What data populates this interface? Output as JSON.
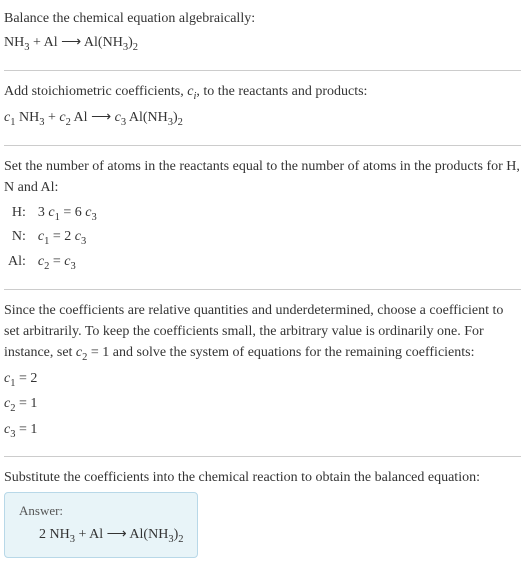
{
  "section1": {
    "title": "Balance the chemical equation algebraically:",
    "equation_left1": "NH",
    "equation_sub1": "3",
    "equation_mid1": " + Al ",
    "equation_arrow": "⟶",
    "equation_right1": " Al(NH",
    "equation_sub2": "3",
    "equation_right2": ")",
    "equation_sub3": "2"
  },
  "section2": {
    "text_a": "Add stoichiometric coefficients, ",
    "ci_c": "c",
    "ci_i": "i",
    "text_b": ", to the reactants and products:",
    "c1": "c",
    "c1s": "1",
    "t1": " NH",
    "s1": "3",
    "t2": " + ",
    "c2": "c",
    "c2s": "2",
    "t3": " Al ",
    "arrow": "⟶",
    "t4": " ",
    "c3": "c",
    "c3s": "3",
    "t5": " Al(NH",
    "s2": "3",
    "t6": ")",
    "s3": "2"
  },
  "section3": {
    "text": "Set the number of atoms in the reactants equal to the number of atoms in the products for H, N and Al:",
    "rows": [
      {
        "label": "H:",
        "lhs_a": "3 ",
        "lhs_c": "c",
        "lhs_s": "1",
        "eq": " = 6 ",
        "rhs_c": "c",
        "rhs_s": "3"
      },
      {
        "label": "N:",
        "lhs_a": "",
        "lhs_c": "c",
        "lhs_s": "1",
        "eq": " = 2 ",
        "rhs_c": "c",
        "rhs_s": "3"
      },
      {
        "label": "Al:",
        "lhs_a": "",
        "lhs_c": "c",
        "lhs_s": "2",
        "eq": " = ",
        "rhs_c": "c",
        "rhs_s": "3"
      }
    ]
  },
  "section4": {
    "text_a": "Since the coefficients are relative quantities and underdetermined, choose a coefficient to set arbitrarily. To keep the coefficients small, the arbitrary value is ordinarily one. For instance, set ",
    "c2c": "c",
    "c2s": "2",
    "text_b": " = 1 and solve the system of equations for the remaining coefficients:",
    "lines": [
      {
        "c": "c",
        "s": "1",
        "val": " = 2"
      },
      {
        "c": "c",
        "s": "2",
        "val": " = 1"
      },
      {
        "c": "c",
        "s": "3",
        "val": " = 1"
      }
    ]
  },
  "section5": {
    "text": "Substitute the coefficients into the chemical reaction to obtain the balanced equation:",
    "answer_label": "Answer:",
    "eq_a": "2 NH",
    "eq_s1": "3",
    "eq_b": " + Al ",
    "eq_arrow": "⟶",
    "eq_c": " Al(NH",
    "eq_s2": "3",
    "eq_d": ")",
    "eq_s3": "2"
  }
}
